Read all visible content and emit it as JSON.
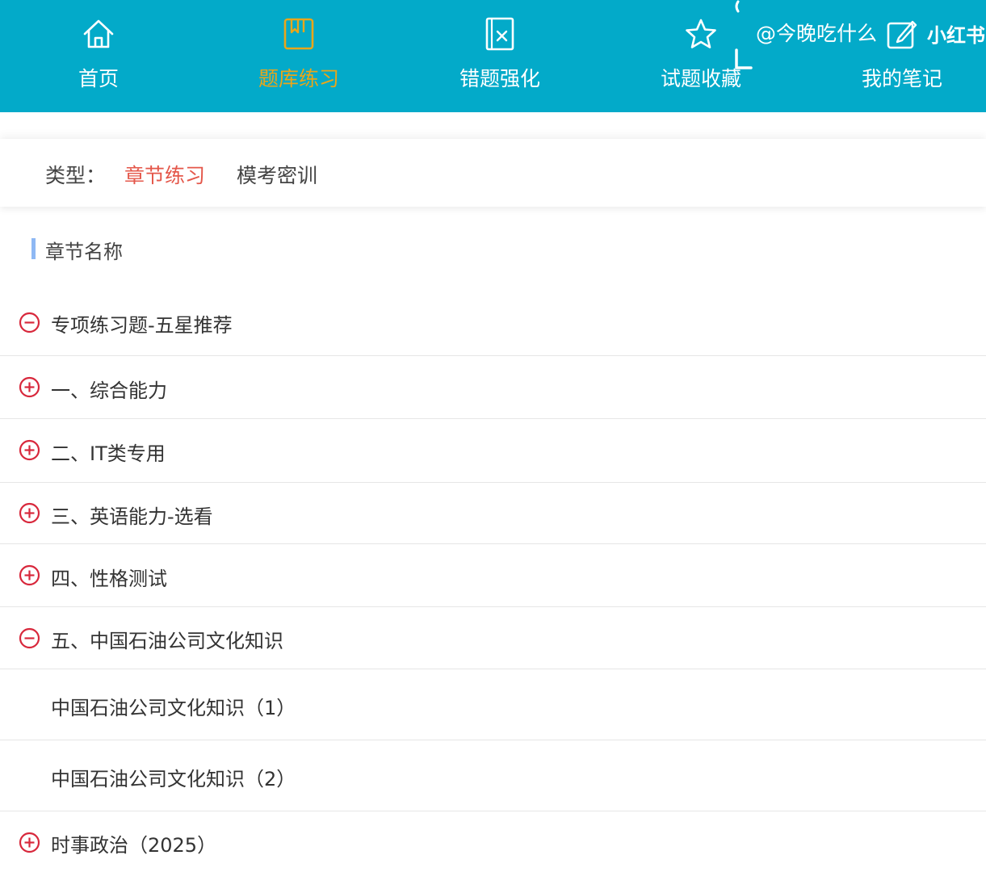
{
  "nav": {
    "items": [
      {
        "label": "首页",
        "icon": "home-icon"
      },
      {
        "label": "题库练习",
        "icon": "book-icon",
        "active": true
      },
      {
        "label": "错题强化",
        "icon": "wrong-doc-icon"
      },
      {
        "label": "试题收藏",
        "icon": "star-icon"
      },
      {
        "label": "我的笔记",
        "icon": "note-icon"
      }
    ],
    "accent_color": "#03aac9",
    "active_color": "#e9a61a"
  },
  "watermark": {
    "handle": "@今晚吃什么",
    "brand": "小红书"
  },
  "type_filter": {
    "label": "类型：",
    "options": [
      "章节练习",
      "模考密训"
    ],
    "selected": "章节练习",
    "selected_color": "#e4574a"
  },
  "section": {
    "title": "章节名称"
  },
  "chapters": [
    {
      "label": "专项练习题-五星推荐",
      "state": "expanded"
    },
    {
      "label": "一、综合能力",
      "state": "collapsed"
    },
    {
      "label": "二、IT类专用",
      "state": "collapsed"
    },
    {
      "label": "三、英语能力-选看",
      "state": "collapsed"
    },
    {
      "label": "四、性格测试",
      "state": "collapsed"
    },
    {
      "label": "五、中国石油公司文化知识",
      "state": "expanded"
    },
    {
      "label": "中国石油公司文化知识（1）",
      "state": "child"
    },
    {
      "label": "中国石油公司文化知识（2）",
      "state": "child"
    },
    {
      "label": "时事政治（2025）",
      "state": "collapsed"
    }
  ]
}
